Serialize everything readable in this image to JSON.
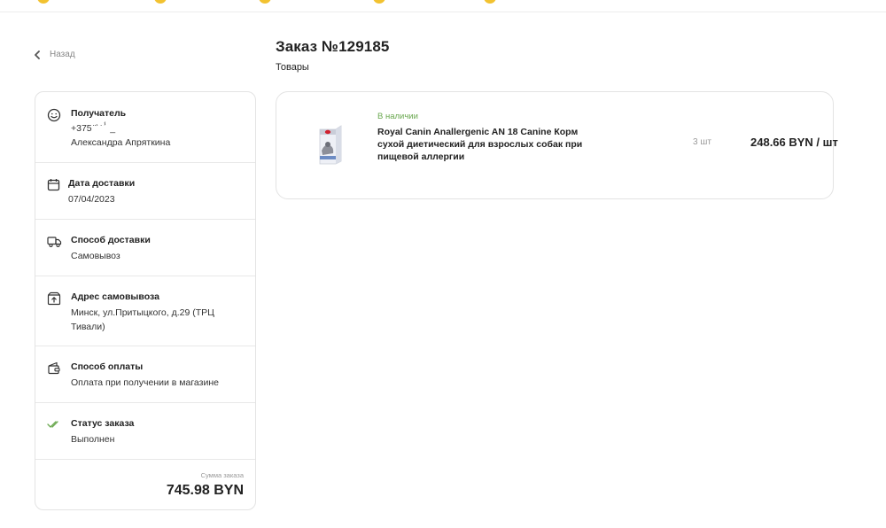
{
  "nav": {
    "back_label": "Назад"
  },
  "order": {
    "title": "Заказ №129185",
    "goods_label": "Товары"
  },
  "info": {
    "recipient": {
      "title": "Получатель",
      "phone": "+375 ̈ ͐ ͘ ⸯ _",
      "name": "Александра Апряткина"
    },
    "delivery_date": {
      "title": "Дата доставки",
      "value": "07/04/2023"
    },
    "delivery_method": {
      "title": "Способ доставки",
      "value": "Самовывоз"
    },
    "pickup_address": {
      "title": "Адрес самовывоза",
      "value": "Минск, ул.Притыцкого, д.29 (ТРЦ Тивали)"
    },
    "payment_method": {
      "title": "Способ оплаты",
      "value": "Оплата при получении в магазине"
    },
    "status": {
      "title": "Статус заказа",
      "value": "Выполнен"
    },
    "total": {
      "label": "Сумма заказа",
      "value": "745.98 BYN"
    }
  },
  "product": {
    "availability": "В наличии",
    "name": "Royal Canin Anallergenic AN 18 Canine Корм сухой диетический для взрослых собак при пищевой аллергии",
    "quantity": "3 шт",
    "price": "248.66 BYN / шт"
  },
  "colors": {
    "accent_green": "#6aa84f",
    "border": "#e3e3e3",
    "brand_red": "#d0202e",
    "top_accent": "#f2c230"
  },
  "icons": [
    "chevron-left-icon",
    "smile-icon",
    "calendar-icon",
    "truck-icon",
    "pickup-box-icon",
    "wallet-icon",
    "double-check-icon"
  ]
}
